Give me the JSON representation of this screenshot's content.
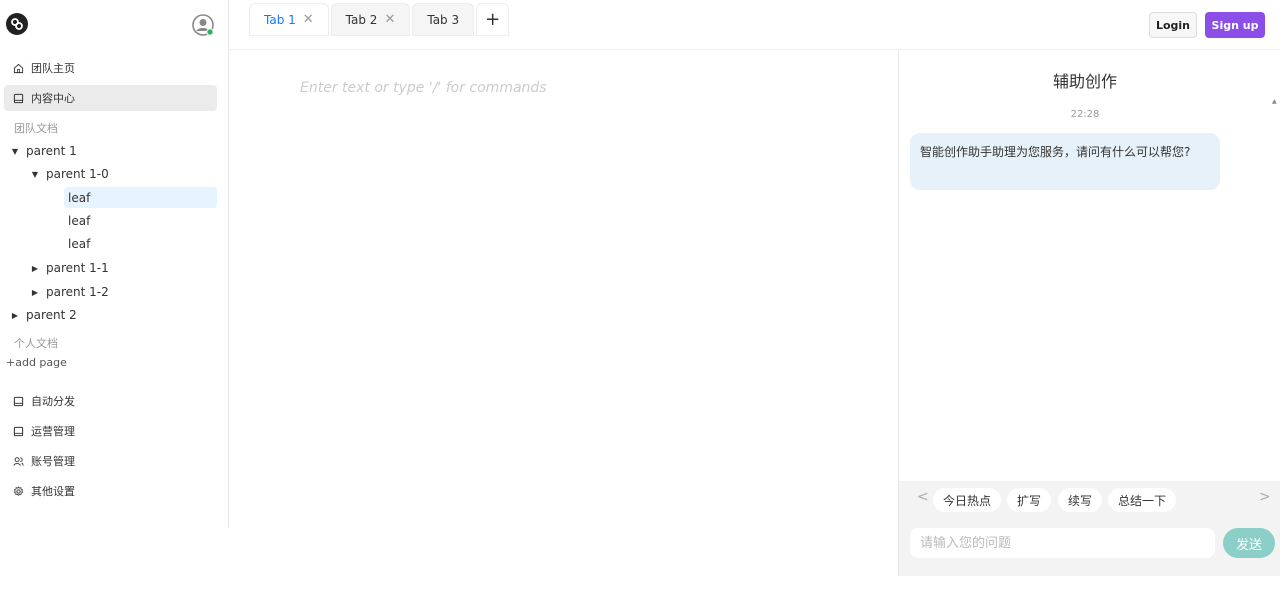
{
  "sidebar": {
    "menu_top": [
      {
        "label": "团队主页",
        "icon": "home-icon"
      },
      {
        "label": "内容中心",
        "icon": "book-icon"
      }
    ],
    "team_docs_label": "团队文档",
    "tree": {
      "parent1": "parent 1",
      "parent1_0": "parent 1-0",
      "leaves": [
        "leaf",
        "leaf",
        "leaf"
      ],
      "parent1_1": "parent 1-1",
      "parent1_2": "parent 1-2",
      "parent2": "parent 2"
    },
    "personal_docs_label": "个人文档",
    "add_page": "+add page",
    "menu_bottom": [
      {
        "label": "自动分发",
        "icon": "book-icon"
      },
      {
        "label": "运营管理",
        "icon": "book-icon"
      },
      {
        "label": "账号管理",
        "icon": "users-icon"
      },
      {
        "label": "其他设置",
        "icon": "gear-icon"
      }
    ]
  },
  "tabs": [
    {
      "label": "Tab 1",
      "closable": true,
      "active": true
    },
    {
      "label": "Tab 2",
      "closable": true,
      "active": false
    },
    {
      "label": "Tab 3",
      "closable": false,
      "active": false
    }
  ],
  "tab_add": "+",
  "header": {
    "login": "Login",
    "signup": "Sign up"
  },
  "editor": {
    "placeholder": "Enter text or type '/' for commands"
  },
  "chat": {
    "title": "辅助创作",
    "time": "22:28",
    "message": "智能创作助手助理为您服务，请问有什么可以帮您?",
    "chips": [
      "今日热点",
      "扩写",
      "续写",
      "总结一下"
    ],
    "input_placeholder": "请输入您的问题",
    "send": "发送"
  },
  "colors": {
    "accent": "#1677ff",
    "signup": "#8b4fe8",
    "send": "#8ccfc8",
    "bubble": "#e6f1f9"
  }
}
